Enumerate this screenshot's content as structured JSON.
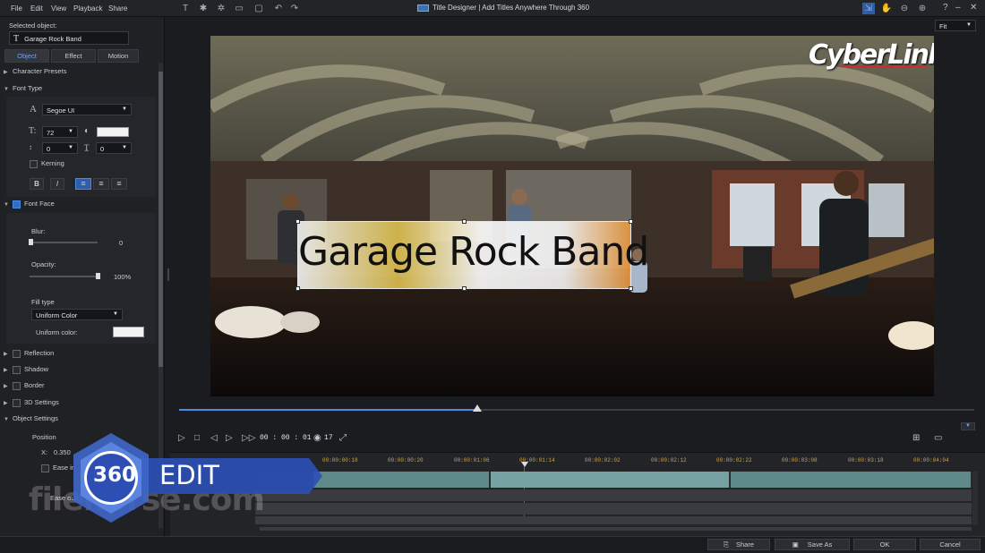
{
  "menu": [
    "File",
    "Edit",
    "View",
    "Playback",
    "Share"
  ],
  "window_title": "Title Designer | Add Titles Anywhere Through 360",
  "window_controls": [
    "?",
    "–",
    "✕"
  ],
  "left": {
    "selected_object_label": "Selected object:",
    "selected_object_value": "Garage Rock Band",
    "tabs": [
      "Object",
      "Effect",
      "Motion"
    ],
    "character_presets": "Character Presets",
    "font_type": "Font Type",
    "font_name": "Segoe UI",
    "font_size": "72",
    "line_spacing": "0",
    "char_spacing": "0",
    "kerning": "Kerning",
    "font_face": "Font Face",
    "blur_label": "Blur:",
    "blur_value": "0",
    "opacity_label": "Opacity:",
    "opacity_value": "100%",
    "fill_type_label": "Fill type",
    "fill_type_value": "Uniform Color",
    "uniform_color_label": "Uniform color:",
    "reflection": "Reflection",
    "shadow": "Shadow",
    "border": "Border",
    "settings_3d": "3D Settings",
    "object_settings": "Object Settings",
    "position_label": "Position",
    "x_label": "X:",
    "x_value": "0.350",
    "ease_in": "Ease in",
    "ease_out": "Ease out"
  },
  "preview": {
    "logo": "CyberLink",
    "title_text": "Garage Rock Band",
    "fit_label": "Fit"
  },
  "playback": {
    "timecode": "00 : 00 : 01 : 17"
  },
  "ruler_ticks": [
    "00:00:00:18",
    "00:00:00:20",
    "00:00:01:06",
    "00:00:01:14",
    "00:00:02:02",
    "00:00:02:12",
    "00:00:02:22",
    "00:00:03:08",
    "00:00:03:18",
    "00:00:04:04"
  ],
  "overlay": {
    "badge_text": "360",
    "banner_text": "EDIT",
    "watermark": "filehorse.com"
  },
  "bottom_buttons": {
    "share": "Share",
    "save_as": "Save As",
    "ok": "OK",
    "cancel": "Cancel"
  },
  "colors": {
    "accent": "#4a8ae0",
    "banner": "#2d4fb3",
    "playhead": "#d23a2a"
  }
}
